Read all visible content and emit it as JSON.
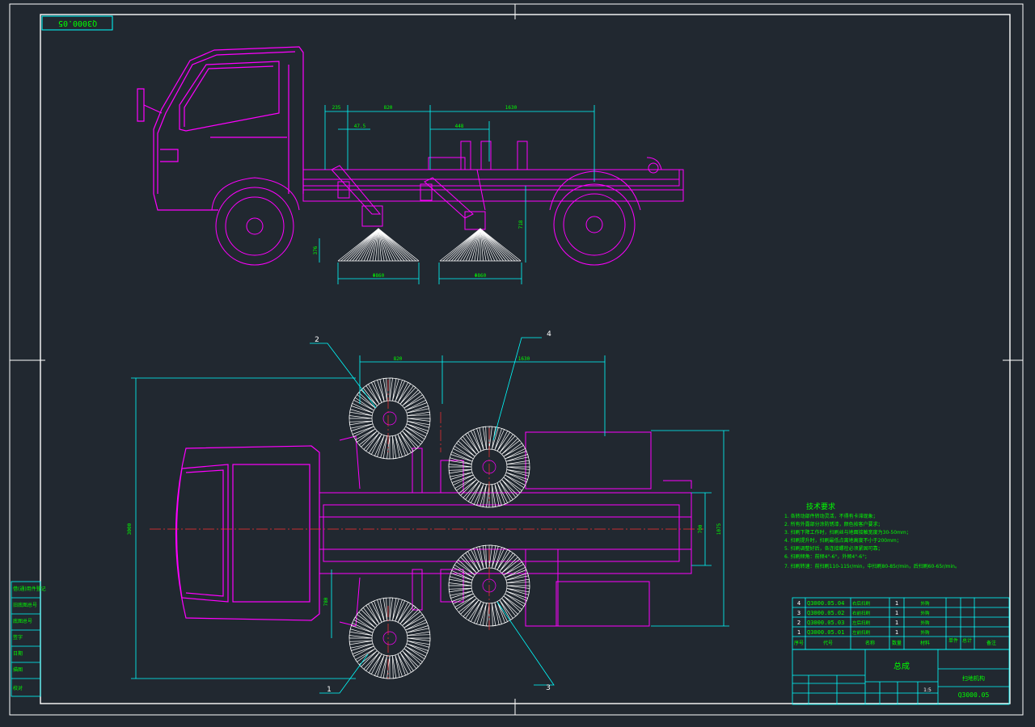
{
  "drawing": {
    "code": "Q3000.05",
    "title": "总成",
    "project": "扫地机构",
    "scale": "1:5"
  },
  "dimensions_side": [
    "235",
    "820",
    "1630",
    "47.5",
    "448",
    "718",
    "376",
    "Φ860",
    "Φ860"
  ],
  "dimensions_plan": [
    "820",
    "1630",
    "3000",
    "700",
    "1075",
    "780"
  ],
  "balloons": [
    "1",
    "2",
    "3",
    "4"
  ],
  "tech_requirements": {
    "heading": "技术要求",
    "lines": [
      "1. 各转动部件转动灵活，不得有卡滞现象；",
      "2. 所有外露部分涂防锈漆，颜色按客户要求；",
      "3. 扫刷下降工作时，扫刷丝与地面接触宽度为30-50mm；",
      "4. 扫刷提升时，扫刷最低点离地高度不小于200mm；",
      "5. 扫刷调整好后，各连接螺栓必须紧固可靠；",
      "6. 扫刷倾角：前倾4°-6°，外倾4°-6°；",
      "7. 扫刷转速：前扫刷110-115r/min，中扫刷80-85r/min，后扫刷60-65r/min。"
    ]
  },
  "bom": {
    "rows": [
      {
        "no": "4",
        "code": "Q3000.05.04",
        "name": "右后扫刷",
        "qty": "1",
        "note": "外购"
      },
      {
        "no": "3",
        "code": "Q3000.05.02",
        "name": "右前扫刷",
        "qty": "1",
        "note": "外购"
      },
      {
        "no": "2",
        "code": "Q3000.05.03",
        "name": "左后扫刷",
        "qty": "1",
        "note": "外购"
      },
      {
        "no": "1",
        "code": "Q3000.05.01",
        "name": "左前扫刷",
        "qty": "1",
        "note": "外购"
      }
    ],
    "headers": [
      "序号",
      "代号",
      "名称",
      "数量",
      "材料",
      "单件",
      "总计",
      "备注"
    ]
  },
  "left_strip": [
    "借(通)用件登记",
    "旧底图总号",
    "底图总号",
    "签字",
    "日期",
    "描图",
    "校对"
  ],
  "colors": {
    "background": "#212830",
    "frame": "#ffffff",
    "outline": "#ff00ff",
    "dimension": "#00ffff",
    "text": "#00ff00",
    "centerline": "#ff3030",
    "detail": "#ffffff"
  }
}
